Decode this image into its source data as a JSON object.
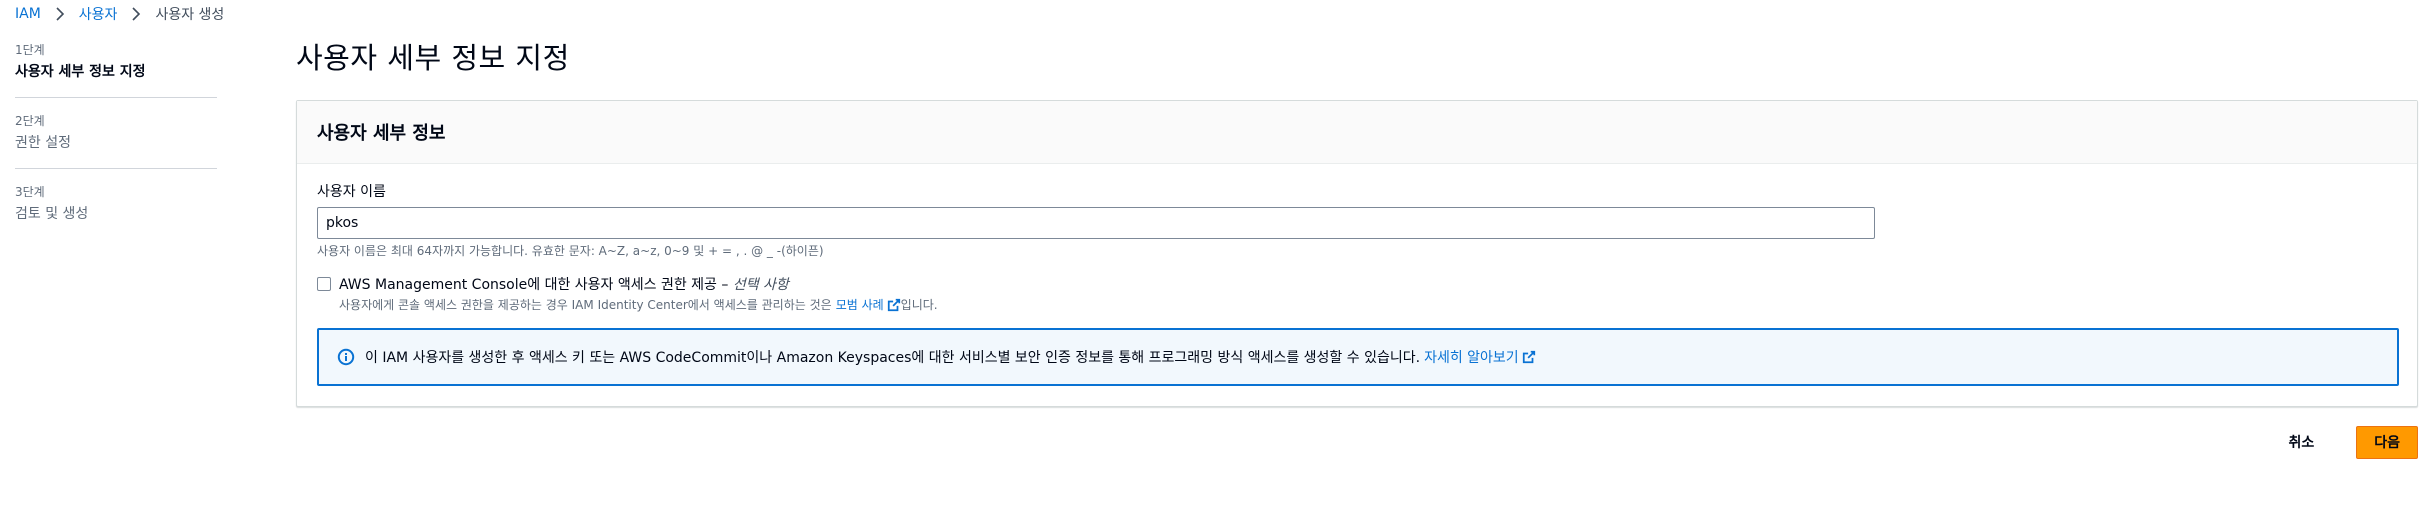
{
  "breadcrumb": {
    "items": [
      "IAM",
      "사용자"
    ],
    "current": "사용자 생성"
  },
  "steps": [
    {
      "num": "1단계",
      "label": "사용자 세부 정보 지정",
      "active": true
    },
    {
      "num": "2단계",
      "label": "권한 설정",
      "active": false
    },
    {
      "num": "3단계",
      "label": "검토 및 생성",
      "active": false
    }
  ],
  "page_title": "사용자 세부 정보 지정",
  "panel": {
    "title": "사용자 세부 정보",
    "username_label": "사용자 이름",
    "username_value": "pkos",
    "username_hint": "사용자 이름은 최대 64자까지 가능합니다. 유효한 문자: A~Z, a~z, 0~9 및 + = , . @ _ -(하이픈)",
    "console_access": {
      "label": "AWS Management Console에 대한 사용자 액세스 권한 제공 – ",
      "optional": "선택 사항",
      "desc_before": "사용자에게 콘솔 액세스 권한을 제공하는 경우 IAM Identity Center에서 액세스를 관리하는 것은 ",
      "desc_link": "모범 사례",
      "desc_after": "입니다.",
      "checked": false
    },
    "info": {
      "text": "이 IAM 사용자를 생성한 후 액세스 키 또는 AWS CodeCommit이나 Amazon Keyspaces에 대한 서비스별 보안 인증 정보를 통해 프로그래밍 방식 액세스를 생성할 수 있습니다.",
      "link": "자세히 알아보기"
    }
  },
  "actions": {
    "cancel": "취소",
    "next": "다음"
  },
  "colors": {
    "link": "#0972d3",
    "primary": "#ff9900",
    "info_border": "#0972d3",
    "info_bg": "#f2f8fd"
  },
  "icons": {
    "breadcrumb_separator": "chevron-right-icon",
    "external": "external-link-icon",
    "info": "info-icon"
  }
}
